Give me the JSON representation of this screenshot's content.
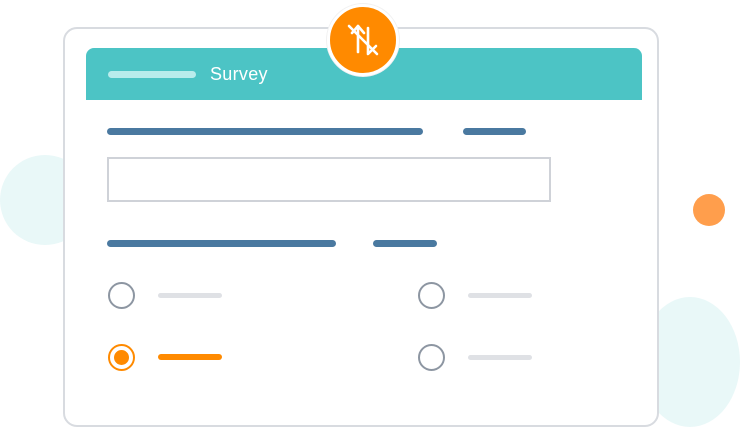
{
  "colors": {
    "accent": "#ff8a00",
    "header_bg": "#4cc4c5",
    "question_line": "#4a79a0",
    "placeholder_line": "#dfe1e5"
  },
  "badge": {
    "icon": "no-translate-icon"
  },
  "header": {
    "title": "Survey"
  },
  "form": {
    "question_1": {
      "input_value": ""
    },
    "question_2": {
      "options": [
        {
          "selected": false
        },
        {
          "selected": false
        },
        {
          "selected": true
        },
        {
          "selected": false
        }
      ]
    }
  }
}
